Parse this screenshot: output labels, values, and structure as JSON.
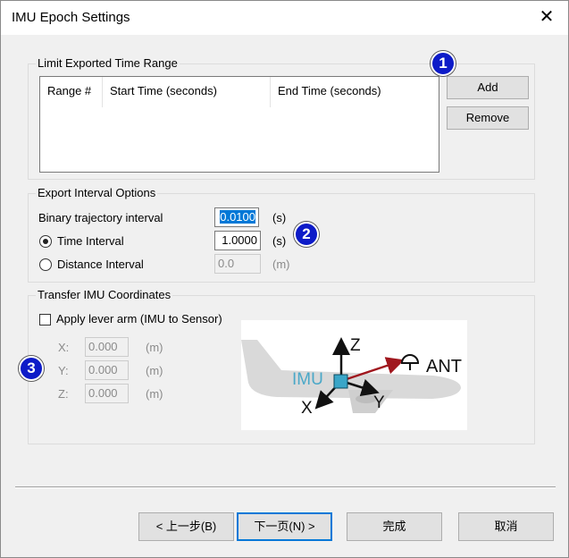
{
  "window": {
    "title": "IMU Epoch Settings",
    "close_glyph": "✕"
  },
  "time_range": {
    "group_label": "Limit Exported Time Range",
    "columns": [
      "Range #",
      "Start Time (seconds)",
      "End Time (seconds)"
    ],
    "add_label": "Add",
    "remove_label": "Remove"
  },
  "export_interval": {
    "group_label": "Export Interval Options",
    "binary_label": "Binary trajectory interval",
    "binary_value": "0.0100",
    "binary_unit": "(s)",
    "time_interval_label": "Time Interval",
    "time_interval_value": "1.0000",
    "time_interval_unit": "(s)",
    "time_interval_selected": true,
    "distance_label": "Distance Interval",
    "distance_value": "0.0",
    "distance_unit": "(m)"
  },
  "transfer": {
    "group_label": "Transfer IMU Coordinates",
    "lever_arm_label": "Apply lever arm (IMU to Sensor)",
    "lever_arm_checked": false,
    "x_label": "X:",
    "x_value": "0.000",
    "x_unit": "(m)",
    "y_label": "Y:",
    "y_value": "0.000",
    "y_unit": "(m)",
    "z_label": "Z:",
    "z_value": "0.000",
    "z_unit": "(m)",
    "diagram": {
      "imu": "IMU",
      "ant": "ANT",
      "z": "Z",
      "x": "X",
      "y": "Y"
    }
  },
  "badges": [
    "1",
    "2",
    "3"
  ],
  "footer": {
    "back_label": "< 上一步(B)",
    "next_label": "下一页(N) >",
    "finish_label": "完成",
    "cancel_label": "取消"
  },
  "colors": {
    "badge": "#0d1bc8",
    "accent": "#0078d7",
    "arrow": "#a0171e",
    "imu_text": "#4aa8c8"
  }
}
